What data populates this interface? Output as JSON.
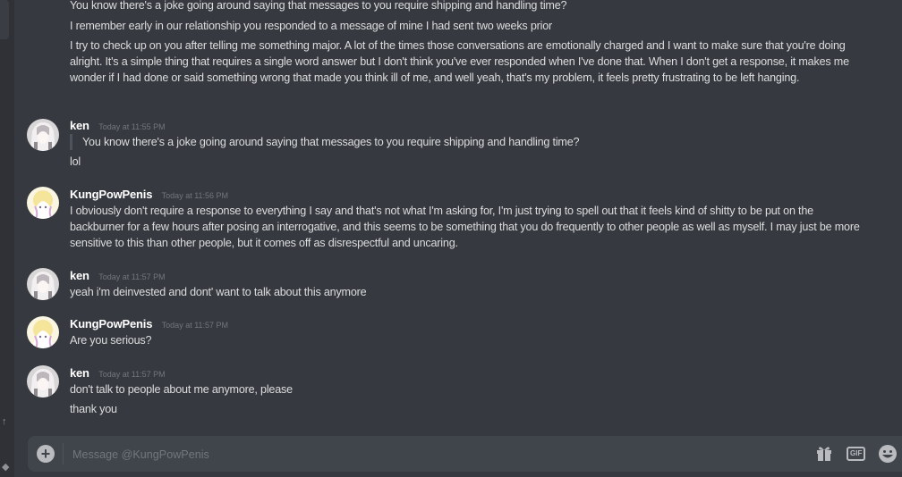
{
  "messages": {
    "continued": [
      "You know there's a joke going around saying that messages to you require shipping and handling time?",
      "I remember early in our relationship you responded to a message of mine I had sent two weeks prior",
      "I try to check up on you after telling me something major. A lot of the times those conversations are emotionally charged and I want to make sure that you're doing alright. It's a simple thing that requires a single word answer but I don't think you've ever responded when I've done that. When I don't get a response, it makes me wonder if I had done or said something wrong that made you think ill of me, and well yeah, that's my problem, it feels pretty frustrating to be left hanging."
    ],
    "groups": [
      {
        "author": "ken",
        "timestamp": "Today at 11:55 PM",
        "quote": "You know there's a joke going around saying that messages to you require shipping and handling time?",
        "lines": [
          "lol"
        ]
      },
      {
        "author": "KungPowPenis",
        "timestamp": "Today at 11:56 PM",
        "lines": [
          "I obviously don't require a response to everything I say and that's not what I'm asking for, I'm just trying to spell out that it feels kind of shitty to be put on the backburner for a few hours after posing an interrogative, and this seems to be something that you do frequently to other people as well as myself. I may just be more sensitive to this than other people, but it comes off as disrespectful and uncaring."
        ]
      },
      {
        "author": "ken",
        "timestamp": "Today at 11:57 PM",
        "lines": [
          "yeah i'm deinvested and dont' want to talk about this anymore"
        ]
      },
      {
        "author": "KungPowPenis",
        "timestamp": "Today at 11:57 PM",
        "lines": [
          "Are you serious?"
        ]
      },
      {
        "author": "ken",
        "timestamp": "Today at 11:57 PM",
        "lines": [
          "don't talk to people about me anymore, please",
          "thank you"
        ]
      }
    ]
  },
  "composer": {
    "placeholder": "Message @KungPowPenis",
    "gif_label": "GIF",
    "icons": [
      "plus-circle-icon",
      "gift-icon",
      "gif-icon",
      "emoji-icon"
    ]
  },
  "colors": {
    "background": "#36393f",
    "sidebar": "#2f3136",
    "composer": "#40444b",
    "text": "#dcddde",
    "muted": "#72767d"
  }
}
